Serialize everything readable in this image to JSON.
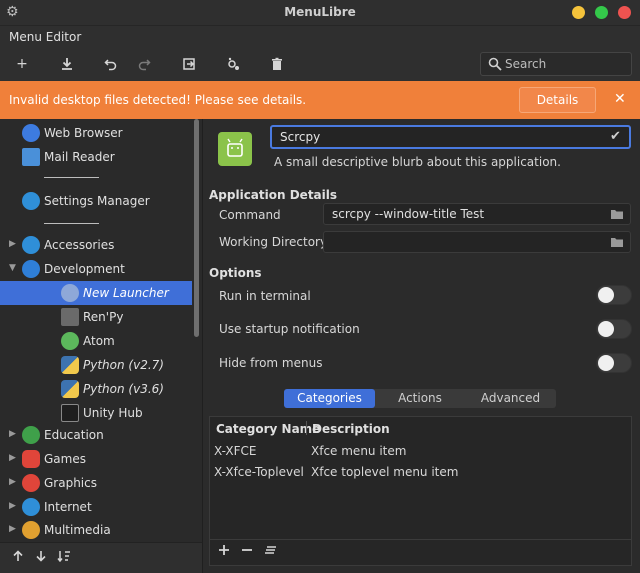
{
  "window": {
    "title": "MenuLibre"
  },
  "menubar": {
    "items": [
      "Menu Editor"
    ]
  },
  "toolbar": {
    "add": "+",
    "search_placeholder": "Search"
  },
  "infobar": {
    "message": "Invalid desktop files detected! Please see details.",
    "details_label": "Details",
    "close_label": "✕"
  },
  "sidebar": {
    "items": [
      {
        "label": "Web Browser",
        "icon": "globe-icon",
        "color": "#3d7be0"
      },
      {
        "label": "Mail Reader",
        "icon": "mail-icon",
        "color": "#4a90d9"
      },
      {
        "label": "Settings Manager",
        "icon": "settings-icon",
        "color": "#2f8fd8"
      },
      {
        "label": "Accessories",
        "icon": "accessories-icon",
        "color": "#2f8fd8"
      },
      {
        "label": "Development",
        "icon": "development-icon",
        "color": "#2f7fd8"
      },
      {
        "label": "New Launcher",
        "icon": "gear-icon",
        "color": "#8ea8d8"
      },
      {
        "label": "Ren'Py",
        "icon": "renpy-icon",
        "color": "#888888"
      },
      {
        "label": "Atom",
        "icon": "atom-icon",
        "color": "#5cb85c"
      },
      {
        "label": "Python (v2.7)",
        "icon": "python-icon",
        "color": "#3d73b0"
      },
      {
        "label": "Python (v3.6)",
        "icon": "python-icon",
        "color": "#3d73b0"
      },
      {
        "label": "Unity Hub",
        "icon": "unity-icon",
        "color": "#333333"
      },
      {
        "label": "Education",
        "icon": "education-icon",
        "color": "#3fa04a"
      },
      {
        "label": "Games",
        "icon": "games-icon",
        "color": "#e0453a"
      },
      {
        "label": "Graphics",
        "icon": "graphics-icon",
        "color": "#e0453a"
      },
      {
        "label": "Internet",
        "icon": "internet-icon",
        "color": "#2f8fd8"
      },
      {
        "label": "Multimedia",
        "icon": "multimedia-icon",
        "color": "#e0a030"
      }
    ]
  },
  "editor": {
    "name_value": "Scrcpy",
    "blurb": "A small descriptive blurb about this application.",
    "app_details_heading": "Application Details",
    "command_label": "Command",
    "command_value": "scrcpy --window-title Test",
    "workdir_label": "Working Directory",
    "workdir_value": "",
    "options_heading": "Options",
    "options": [
      {
        "label": "Run in terminal",
        "on": false
      },
      {
        "label": "Use startup notification",
        "on": false
      },
      {
        "label": "Hide from menus",
        "on": false
      }
    ],
    "tabs": [
      "Categories",
      "Actions",
      "Advanced"
    ],
    "active_tab": "Categories",
    "table": {
      "headers": [
        "Category Name",
        "Description"
      ],
      "rows": [
        [
          "X-XFCE",
          "Xfce menu item"
        ],
        [
          "X-Xfce-Toplevel",
          "Xfce toplevel menu item"
        ]
      ]
    }
  },
  "colors": {
    "accent": "#3f6fd8",
    "infobar": "#f0803a",
    "app_icon": "#8bc34a"
  }
}
